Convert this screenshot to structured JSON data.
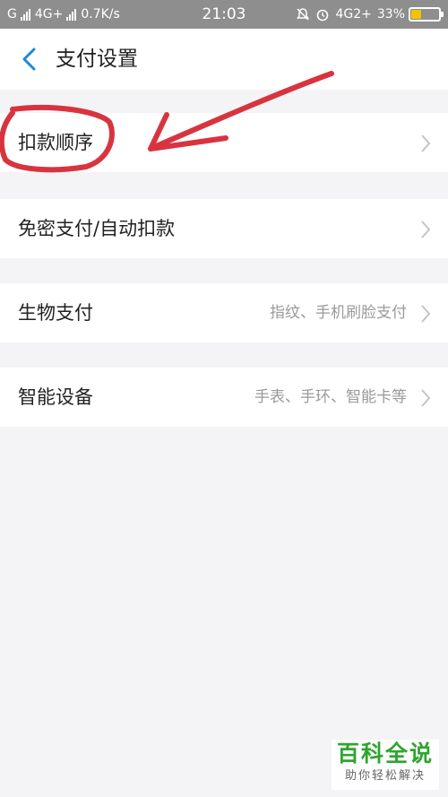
{
  "status_bar": {
    "carrier1": "G",
    "network": "4G+",
    "speed": "0.7K/s",
    "time": "21:03",
    "network_right": "4G2+",
    "battery": "33%",
    "battery_level": 0.33,
    "battery_color": "#f2c300"
  },
  "header": {
    "title": "支付设置",
    "back_icon": "chevron-left-icon",
    "accent": "#1e88d8"
  },
  "settings": [
    {
      "label": "扣款顺序",
      "value": ""
    },
    {
      "label": "免密支付/自动扣款",
      "value": ""
    },
    {
      "label": "生物支付",
      "value": "指纹、手机刷脸支付"
    },
    {
      "label": "智能设备",
      "value": "手表、手环、智能卡等"
    }
  ],
  "annotation_color": "#d8343f",
  "watermark": {
    "main": "百科全说",
    "sub": "助你轻松解决"
  }
}
